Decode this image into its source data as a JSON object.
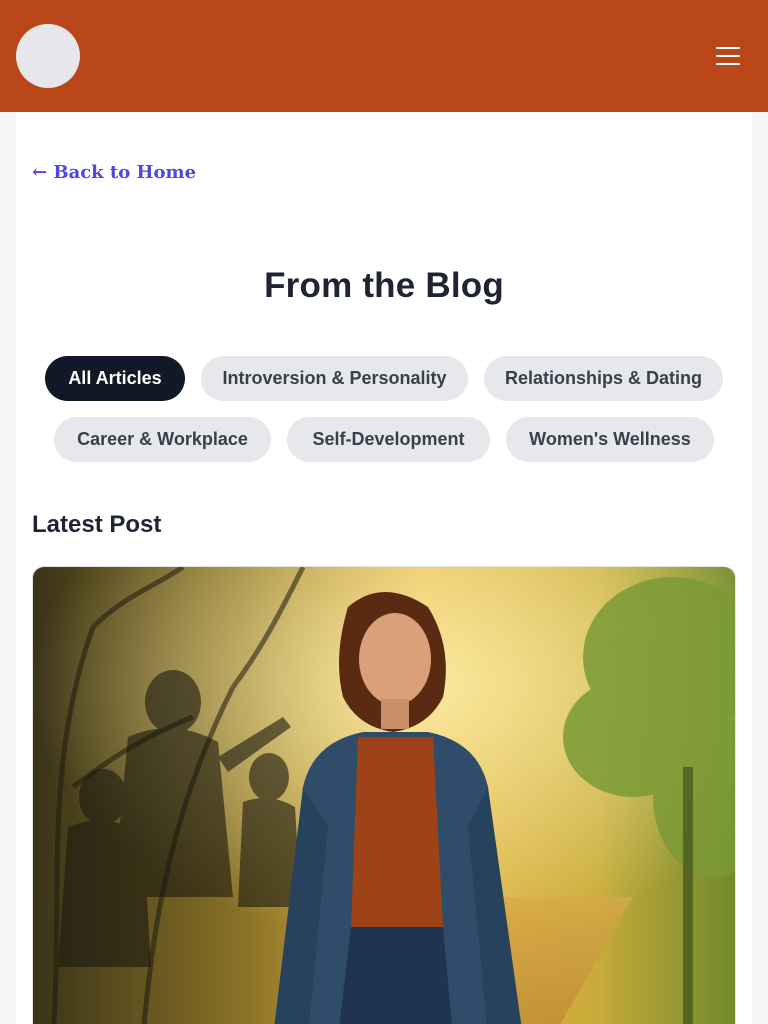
{
  "header": {
    "logo_icon": "logo-placeholder-icon",
    "menu_icon": "hamburger-menu-icon",
    "background": "#b9471a"
  },
  "nav": {
    "back_label": "← Back to Home",
    "link_color": "#4f46e5"
  },
  "blog": {
    "title": "From the Blog",
    "categories": [
      {
        "label": "All Articles",
        "active": true
      },
      {
        "label": "Introversion & Personality",
        "active": false
      },
      {
        "label": "Relationships & Dating",
        "active": false
      },
      {
        "label": "Career & Workplace",
        "active": false
      },
      {
        "label": "Self-Development",
        "active": false
      },
      {
        "label": "Women's Wellness",
        "active": false
      }
    ],
    "latest_heading": "Latest Post",
    "featured_image_icon": "illustration-woman-walking-from-shadows"
  }
}
